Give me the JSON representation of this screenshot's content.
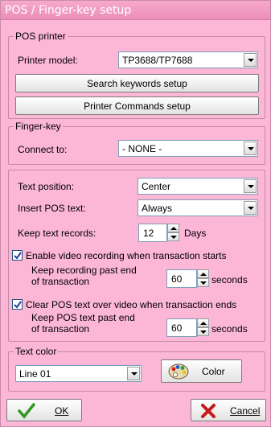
{
  "window": {
    "title": "POS / Finger-key setup"
  },
  "pos_printer": {
    "legend": "POS printer",
    "model_label": "Printer model:",
    "model_value": "TP3688/TP7688",
    "search_keywords_button": "Search keywords setup",
    "printer_commands_button": "Printer Commands setup"
  },
  "finger_key": {
    "legend": "Finger-key",
    "connect_label": "Connect to:",
    "connect_value": "- NONE -"
  },
  "text_settings": {
    "position_label": "Text position:",
    "position_value": "Center",
    "insert_label": "Insert POS text:",
    "insert_value": "Always",
    "keep_records_label": "Keep text records:",
    "keep_records_value": "12",
    "keep_records_unit": "Days"
  },
  "video_recording": {
    "enable_label": "Enable video recording when transaction starts",
    "enable_checked": true,
    "keep_label": "Keep recording past end of transaction",
    "keep_value": "60",
    "keep_unit": "seconds"
  },
  "clear_text": {
    "clear_label": "Clear POS text over video when transaction ends",
    "clear_checked": true,
    "keep_label": "Keep POS text past end of transaction",
    "keep_value": "60",
    "keep_unit": "seconds"
  },
  "text_color": {
    "legend": "Text color",
    "line_value": "Line 01",
    "color_button": "Color"
  },
  "footer": {
    "ok_label": "OK",
    "cancel_label": "Cancel"
  },
  "colors": {
    "background": "#fcb6d6",
    "ok_icon": "#2f9a1f",
    "cancel_icon": "#c81818"
  }
}
